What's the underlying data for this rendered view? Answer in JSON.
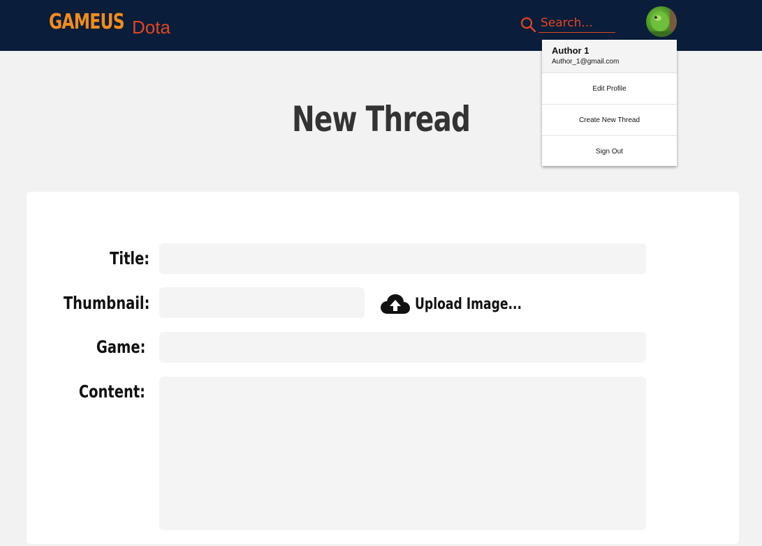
{
  "header": {
    "brand": "GAMEUS",
    "game": "Dota",
    "search": {
      "placeholder": "Search..."
    }
  },
  "page": {
    "title": "New Thread"
  },
  "form": {
    "title_label": "Title:",
    "thumbnail_label": "Thumbnail:",
    "upload_label": "Upload Image...",
    "game_label": "Game:",
    "content_label": "Content:"
  },
  "user_menu": {
    "name": "Author 1",
    "email": "Author_1@gmail.com",
    "items": [
      "Edit Profile",
      "Create New Thread",
      "Sign Out"
    ]
  },
  "colors": {
    "header_bg": "#0a1d3a",
    "brand": "#f28c1c",
    "accent": "#e2461f",
    "page_bg": "#f2f2f2"
  },
  "icons": {
    "search": "search-icon",
    "upload": "cloud-upload-icon",
    "avatar": "avatar"
  }
}
